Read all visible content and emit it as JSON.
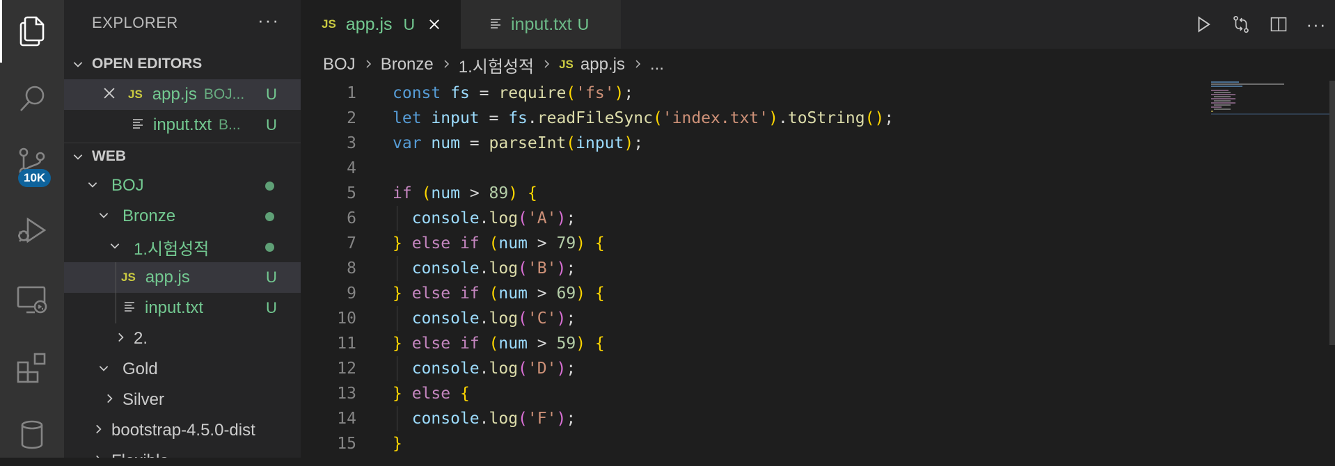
{
  "activity_bar": {
    "items": [
      "files-icon",
      "search-icon",
      "source-control-icon",
      "run-debug-icon",
      "remote-explorer-icon",
      "extensions-icon",
      "database-icon"
    ],
    "source_control_badge": "10K"
  },
  "sidebar": {
    "title": "EXPLORER",
    "more": "···",
    "open_editors": {
      "label": "OPEN EDITORS",
      "items": [
        {
          "icon": "JS",
          "name": "app.js",
          "path": "BOJ...",
          "status": "U"
        },
        {
          "name": "input.txt",
          "path": "B...",
          "status": "U"
        }
      ]
    },
    "workspace": {
      "label": "WEB",
      "tree": {
        "boj": "BOJ",
        "bronze": "Bronze",
        "exam": "1.시험성적",
        "appjs": "app.js",
        "inputtxt": "input.txt",
        "two": "2.",
        "gold": "Gold",
        "silver": "Silver",
        "bootstrap": "bootstrap-4.5.0-dist",
        "flexible": "Flexible"
      },
      "js_tag": "JS",
      "status_u": "U"
    }
  },
  "tabs": [
    {
      "icon": "JS",
      "label": "app.js",
      "status": "U",
      "active": true
    },
    {
      "label": "input.txt",
      "status": "U",
      "active": false
    }
  ],
  "breadcrumb": [
    "BOJ",
    "Bronze",
    "1.시험성적",
    "app.js",
    "..."
  ],
  "breadcrumb_js": "JS",
  "editor": {
    "line_numbers": [
      "1",
      "2",
      "3",
      "4",
      "5",
      "6",
      "7",
      "8",
      "9",
      "10",
      "11",
      "12",
      "13",
      "14",
      "15"
    ]
  },
  "colors": {
    "accent": "#0e639c",
    "git_untracked": "#73c991",
    "js_icon": "#cbcb41",
    "keyword": "#569cd6",
    "string": "#ce9178"
  }
}
